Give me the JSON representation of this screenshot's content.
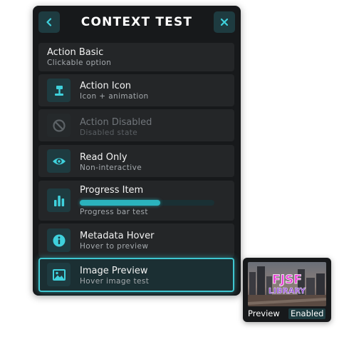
{
  "menu": {
    "title": "CONTEXT TEST",
    "back_icon": "chevron-left-icon",
    "close_icon": "close-icon",
    "items": [
      {
        "label": "Action Basic",
        "description": "Clickable option"
      },
      {
        "label": "Action Icon",
        "description": "Icon + animation",
        "icon": "gavel-icon"
      },
      {
        "label": "Action Disabled",
        "description": "Disabled state",
        "icon": "ban-icon"
      },
      {
        "label": "Read Only",
        "description": "Non-interactive",
        "icon": "eye-icon"
      },
      {
        "label": "Progress Item",
        "description": "Progress bar test",
        "icon": "bar-chart-icon",
        "progress": 0.6
      },
      {
        "label": "Metadata Hover",
        "description": "Hover to preview",
        "icon": "info-icon"
      },
      {
        "label": "Image Preview",
        "description": "Hover image test",
        "icon": "image-icon"
      }
    ]
  },
  "preview": {
    "image_title_line1": "FJSF",
    "image_title_line2": "LIBRARY",
    "caption": "Preview",
    "badge": "Enabled"
  },
  "colors": {
    "accent": "#3fd1dc",
    "panel_bg": "#17191b",
    "item_bg": "#242628",
    "icon_bg": "#1e3b40",
    "logo_pink": "#e83ad6",
    "logo_purple": "#8b3fd6"
  }
}
